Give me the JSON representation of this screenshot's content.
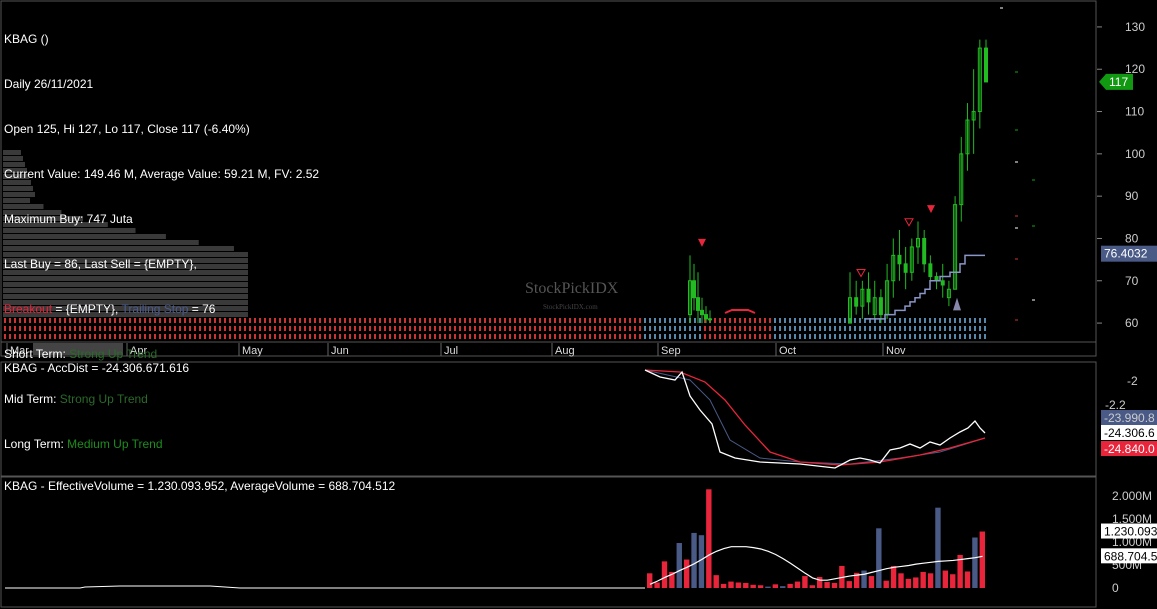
{
  "info": {
    "ticker_line": "KBAG ()",
    "date_line": "Daily 26/11/2021",
    "ohlc_line": "Open 125, Hi 127, Lo 117, Close 117 (-6.40%)",
    "value_line": "Current Value: 149.46 M, Average Value: 59.21 M, FV: 2.52",
    "maxbuy_line": "Maximum Buy: 747 Juta",
    "buysell_line": "Last Buy = 86, Last Sell = {EMPTY},",
    "breakout_label": "Breakout",
    "breakout_value": " = {EMPTY}, ",
    "trailing_label": "Trailing Stop",
    "trailing_value": " = 76",
    "short_label": "Short Term: ",
    "short_value": "Strong Up Trend",
    "mid_label": "Mid Term: ",
    "mid_value": "Strong Up Trend",
    "long_label": "Long Term: ",
    "long_value": "Medium Up Trend"
  },
  "watermark": {
    "main": "StockPickIDX",
    "small": "StockPickIDX.com"
  },
  "colors": {
    "up": "#22bb22",
    "down": "#e8253b",
    "trail": "#8a95c8",
    "vol_blue": "#4a5a86",
    "bg": "#000000"
  },
  "panel2_title": "KBAG - AccDist = -24.306.671.616",
  "panel3_title": "KBAG - EffectiveVolume = 1.230.093.952, AverageVolume = 688.704.512",
  "chart_data": [
    {
      "type": "candlestick",
      "ylim": [
        56,
        134
      ],
      "yticks": [
        "130",
        "120",
        "110",
        "100",
        "90",
        "80",
        "70",
        "60"
      ],
      "months": [
        "Mar",
        "Apr",
        "May",
        "Jun",
        "Jul",
        "Aug",
        "Sep",
        "Oct",
        "Nov"
      ],
      "last_price_label": "117",
      "trailing_stop_label": "76.4032",
      "candles": [
        {
          "o": 62,
          "h": 76,
          "l": 60,
          "c": 70
        },
        {
          "o": 70,
          "h": 74,
          "l": 63,
          "c": 66
        },
        {
          "o": 66,
          "h": 72,
          "l": 60,
          "c": 63
        },
        {
          "o": 63,
          "h": 66,
          "l": 60,
          "c": 62
        },
        {
          "o": 62,
          "h": 64,
          "l": 60,
          "c": 61
        },
        {
          "o": 61,
          "h": 63,
          "l": 60,
          "c": 61
        },
        {
          "o": 60,
          "h": 72,
          "l": 60,
          "c": 66
        },
        {
          "o": 66,
          "h": 70,
          "l": 62,
          "c": 64
        },
        {
          "o": 64,
          "h": 70,
          "l": 61,
          "c": 68
        },
        {
          "o": 68,
          "h": 72,
          "l": 62,
          "c": 65
        },
        {
          "o": 62,
          "h": 70,
          "l": 61,
          "c": 66
        },
        {
          "o": 66,
          "h": 68,
          "l": 60,
          "c": 62
        },
        {
          "o": 62,
          "h": 74,
          "l": 61,
          "c": 70
        },
        {
          "o": 70,
          "h": 80,
          "l": 66,
          "c": 76
        },
        {
          "o": 76,
          "h": 82,
          "l": 70,
          "c": 74
        },
        {
          "o": 74,
          "h": 78,
          "l": 68,
          "c": 72
        },
        {
          "o": 72,
          "h": 80,
          "l": 70,
          "c": 78
        },
        {
          "o": 78,
          "h": 84,
          "l": 74,
          "c": 80
        },
        {
          "o": 80,
          "h": 82,
          "l": 72,
          "c": 74
        },
        {
          "o": 74,
          "h": 76,
          "l": 70,
          "c": 71
        },
        {
          "o": 71,
          "h": 72,
          "l": 68,
          "c": 70
        },
        {
          "o": 70,
          "h": 74,
          "l": 66,
          "c": 69
        },
        {
          "o": 66,
          "h": 70,
          "l": 64,
          "c": 68
        },
        {
          "o": 68,
          "h": 90,
          "l": 68,
          "c": 88
        },
        {
          "o": 88,
          "h": 104,
          "l": 84,
          "c": 100
        },
        {
          "o": 100,
          "h": 112,
          "l": 96,
          "c": 108
        },
        {
          "o": 108,
          "h": 120,
          "l": 100,
          "c": 110
        },
        {
          "o": 110,
          "h": 127,
          "l": 106,
          "c": 125
        },
        {
          "o": 125,
          "h": 127,
          "l": 117,
          "c": 117
        }
      ],
      "trailing_stop": [
        61,
        61,
        61,
        61,
        62,
        62,
        63,
        63,
        64,
        65,
        66,
        67,
        68,
        70,
        70,
        71,
        71,
        72,
        72,
        74,
        76,
        76,
        76,
        76
      ]
    },
    {
      "type": "line",
      "title": "AccDist",
      "yticks": [
        "-2",
        "-2.2"
      ],
      "labels": [
        "-23.990.8",
        "-24.306.6",
        "-24.840.0"
      ]
    },
    {
      "type": "bar",
      "title": "EffectiveVolume",
      "yticks": [
        "2.000M",
        "1.500M",
        "1.000M",
        "500M",
        "0"
      ],
      "ylim": [
        0,
        2200
      ],
      "labels": [
        "1.230.093",
        "688.704.5"
      ],
      "volumes": [
        320,
        120,
        580,
        350,
        980,
        620,
        1200,
        1150,
        2150,
        280,
        90,
        140,
        120,
        110,
        70,
        60,
        30,
        80,
        40,
        90,
        140,
        260,
        60,
        240,
        130,
        110,
        480,
        150,
        330,
        380,
        260,
        1300,
        160,
        480,
        320,
        200,
        230,
        350,
        320,
        1750,
        380,
        300,
        720,
        360,
        1100,
        1230
      ],
      "average": [
        80,
        150,
        230,
        300,
        380,
        450,
        530,
        620,
        720,
        800,
        860,
        900,
        900,
        900,
        880,
        850,
        800,
        730,
        640,
        540,
        430,
        320,
        220,
        170,
        170,
        200,
        230,
        260,
        280,
        300,
        340,
        380,
        420,
        450,
        470,
        490,
        520,
        540,
        560,
        580,
        590,
        600,
        620,
        640,
        660,
        690
      ]
    }
  ]
}
